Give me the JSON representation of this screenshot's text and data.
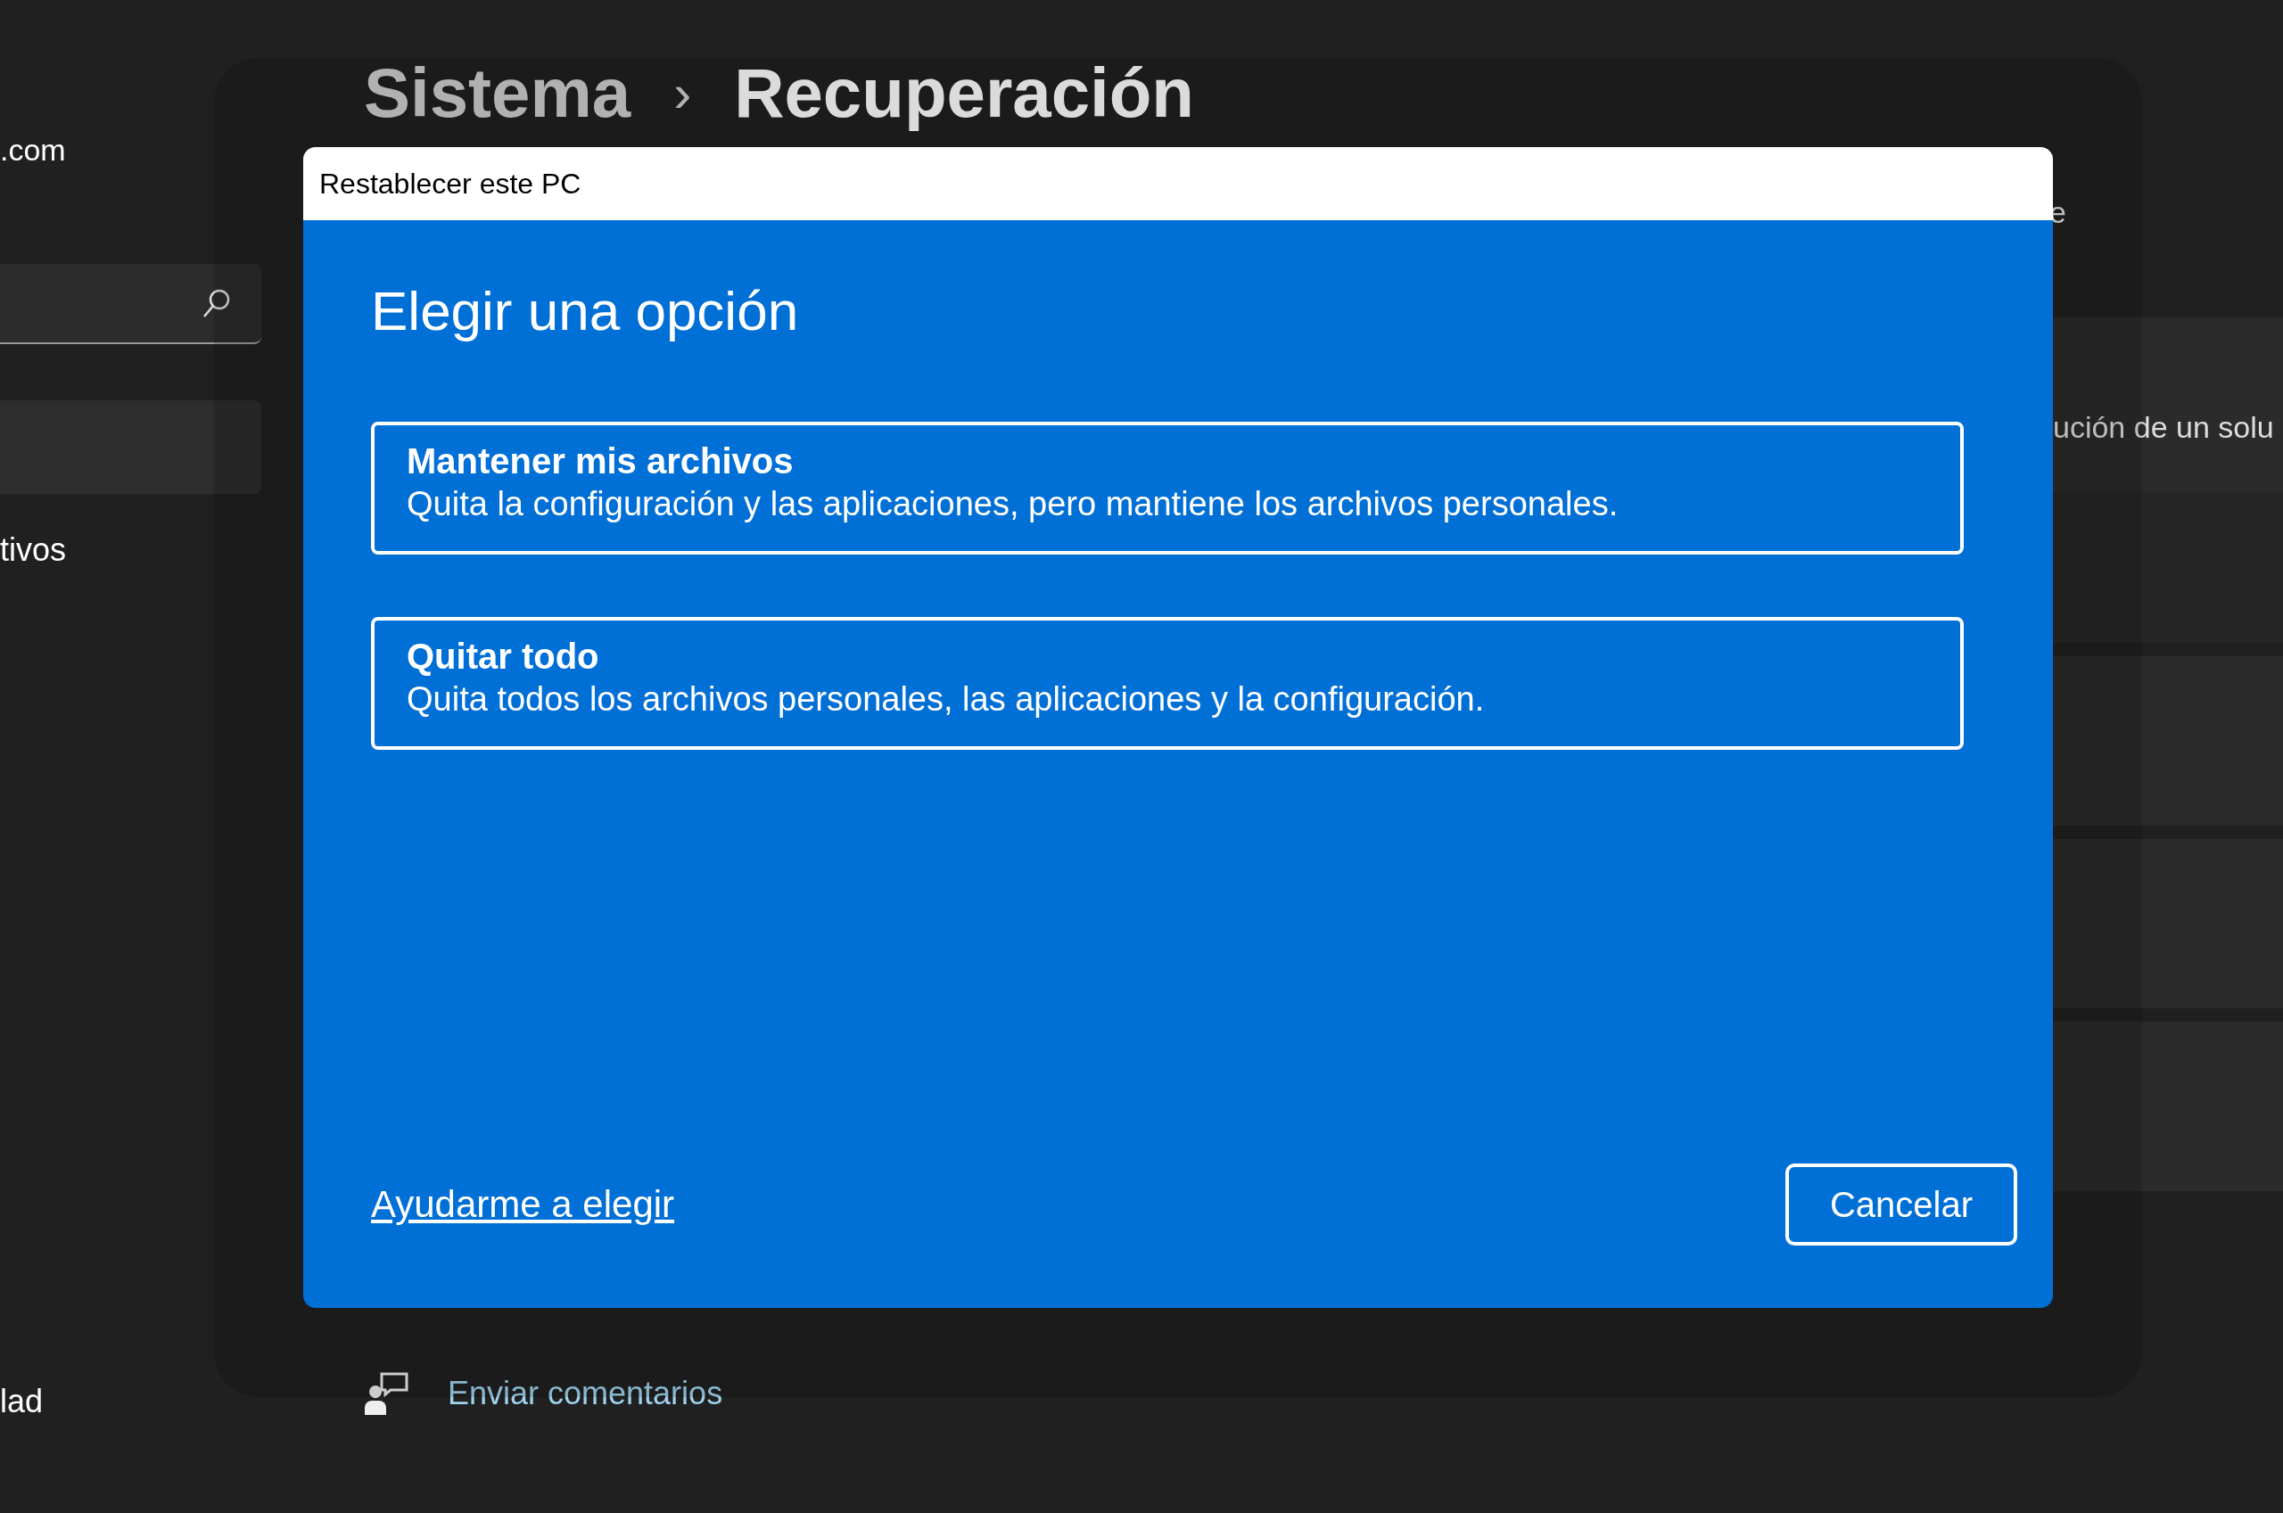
{
  "header": {
    "parent": "Sistema",
    "separator": "›",
    "title": "Recuperación"
  },
  "sidebar": {
    "account": ".com",
    "search": {
      "kind": "search"
    },
    "items": [
      {
        "selected": true
      },
      {
        "label": "tivos",
        "selected": false
      },
      {
        "label": "lad",
        "selected": false
      }
    ]
  },
  "main": {
    "description_fragment": "e",
    "cards": [
      {
        "text": "ución de un solu"
      }
    ],
    "links": [
      {
        "label": "Enviar comentarios"
      }
    ]
  },
  "dialog": {
    "title": "Restablecer este PC",
    "heading": "Elegir una opción",
    "options": [
      {
        "title": "Mantener mis archivos",
        "description": "Quita la configuración y las aplicaciones, pero mantiene los archivos personales."
      },
      {
        "title": "Quitar todo",
        "description": "Quita todos los archivos personales, las aplicaciones y la configuración."
      }
    ],
    "help_link": "Ayudarme a elegir",
    "cancel_button": "Cancelar"
  }
}
